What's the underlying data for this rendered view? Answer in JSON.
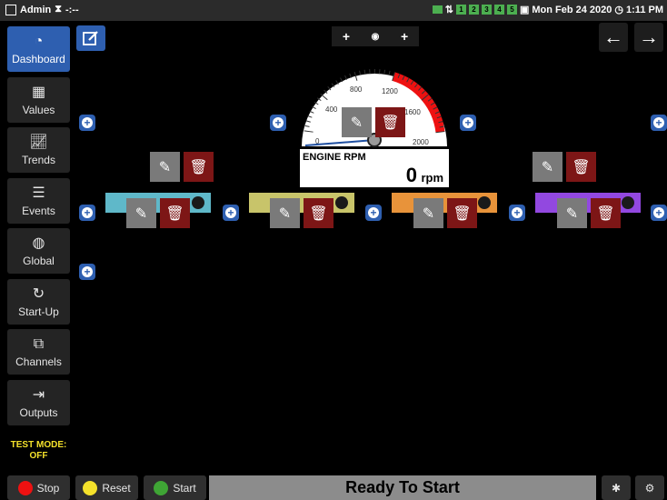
{
  "topbar": {
    "user": "Admin",
    "timer": "-:--",
    "indicators": [
      "1",
      "2",
      "3",
      "4",
      "5"
    ],
    "datetime": "Mon Feb 24 2020",
    "clock": "1:11 PM"
  },
  "sidebar": {
    "items": [
      {
        "label": "Dashboard",
        "icon": "gauge-icon"
      },
      {
        "label": "Values",
        "icon": "table-icon"
      },
      {
        "label": "Trends",
        "icon": "line-chart-icon"
      },
      {
        "label": "Events",
        "icon": "list-icon"
      },
      {
        "label": "Global",
        "icon": "globe-icon"
      },
      {
        "label": "Start-Up",
        "icon": "power-icon"
      },
      {
        "label": "Channels",
        "icon": "sliders-icon"
      },
      {
        "label": "Outputs",
        "icon": "output-icon"
      }
    ],
    "test_mode": "TEST MODE:",
    "test_mode_value": "OFF"
  },
  "gauge": {
    "title": "ENGINE RPM",
    "value": "0",
    "unit": "rpm",
    "ticks": [
      "0",
      "400",
      "800",
      "1200",
      "1600",
      "2000"
    ],
    "redline_start": 1200,
    "max": 2000,
    "current": 0
  },
  "bars": [
    {
      "color": "#5fb8c9"
    },
    {
      "color": "#c8c46a"
    },
    {
      "color": "#e8933a"
    },
    {
      "color": "#9248e0"
    }
  ],
  "bottom": {
    "stop": "Stop",
    "reset": "Reset",
    "start": "Start",
    "status": "Ready To Start"
  },
  "colors": {
    "accent": "#2e5fb0",
    "delete": "#7d1616",
    "edit": "#7a7a7a"
  }
}
